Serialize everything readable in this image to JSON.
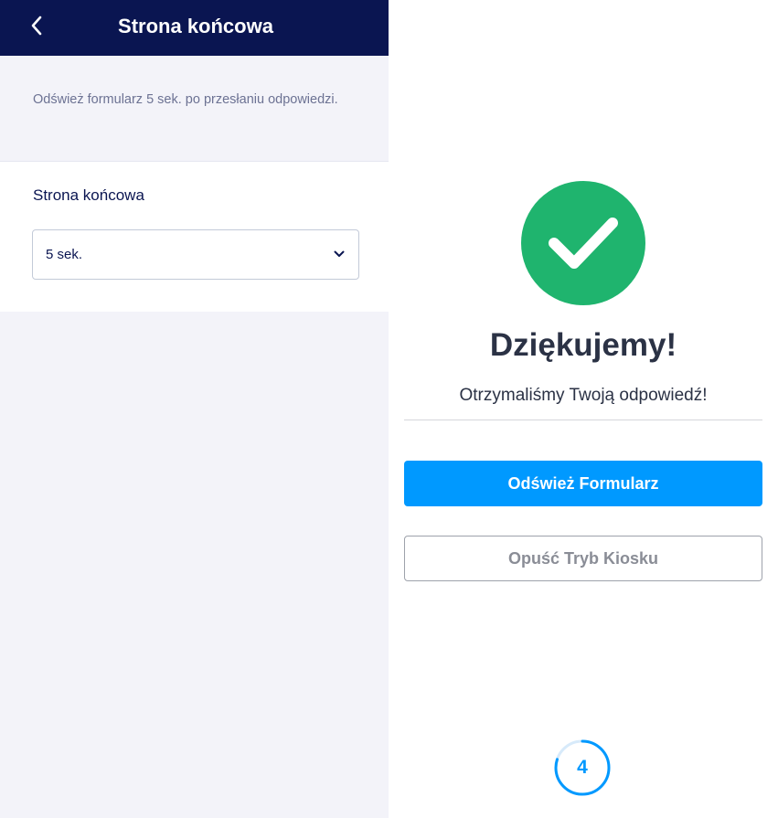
{
  "header": {
    "title": "Strona końcowa",
    "back_icon": "chevron-left-icon"
  },
  "settings": {
    "description": "Odśwież formularz 5 sek. po przesłaniu odpowiedzi.",
    "field_label": "Strona końcowa",
    "select_value": "5 sek.",
    "select_icon": "chevron-down-icon"
  },
  "preview": {
    "success_icon": "check-circle-icon",
    "title": "Dziękujemy!",
    "message": "Otrzymaliśmy Twoją odpowiedź!",
    "refresh_button": "Odśwież Formularz",
    "exit_button": "Opuść Tryb Kiosku",
    "countdown": "4",
    "countdown_progress": 0.2
  },
  "colors": {
    "header_bg": "#0a1551",
    "success_green": "#1fb46e",
    "primary_blue": "#0099ff",
    "panel_bg": "#f3f3f9"
  }
}
